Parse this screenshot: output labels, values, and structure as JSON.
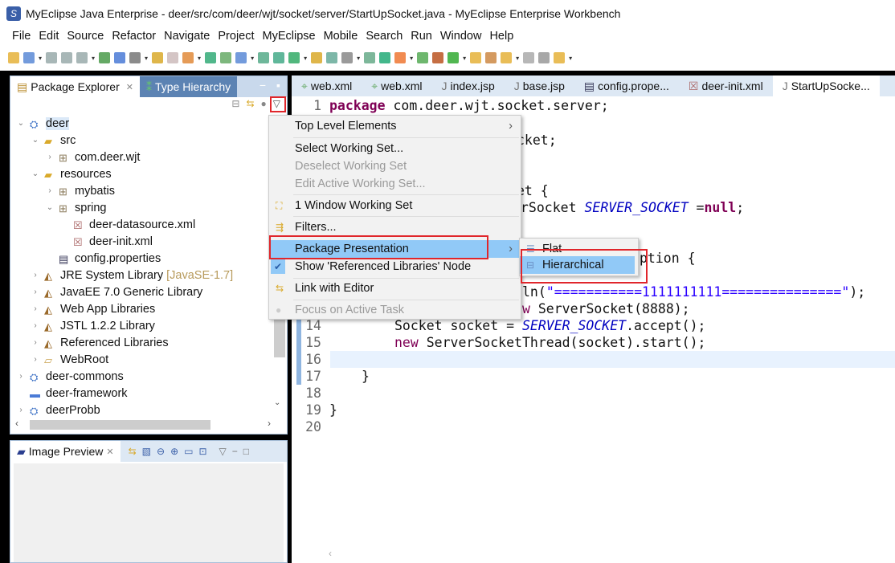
{
  "window": {
    "title": "MyEclipse Java Enterprise - deer/src/com/deer/wjt/socket/server/StartUpSocket.java - MyEclipse Enterprise Workbench"
  },
  "menubar": [
    "File",
    "Edit",
    "Source",
    "Refactor",
    "Navigate",
    "Project",
    "MyEclipse",
    "Mobile",
    "Search",
    "Run",
    "Window",
    "Help"
  ],
  "left_panel": {
    "tabs": [
      {
        "label": "Package Explorer"
      },
      {
        "label": "Type Hierarchy"
      }
    ],
    "tree": [
      {
        "label": "deer",
        "depth": 0,
        "twisty": "v",
        "icon": "project-icon"
      },
      {
        "label": "src",
        "depth": 1,
        "twisty": "v",
        "icon": "source-folder-icon"
      },
      {
        "label": "com.deer.wjt",
        "depth": 2,
        "twisty": ">",
        "icon": "package-icon"
      },
      {
        "label": "resources",
        "depth": 1,
        "twisty": "v",
        "icon": "source-folder-icon"
      },
      {
        "label": "mybatis",
        "depth": 2,
        "twisty": ">",
        "icon": "package-icon"
      },
      {
        "label": "spring",
        "depth": 2,
        "twisty": "v",
        "icon": "package-icon"
      },
      {
        "label": "deer-datasource.xml",
        "depth": 3,
        "twisty": "",
        "icon": "xml-file-icon"
      },
      {
        "label": "deer-init.xml",
        "depth": 3,
        "twisty": "",
        "icon": "xml-file-icon"
      },
      {
        "label": "config.properties",
        "depth": 2,
        "twisty": "",
        "icon": "properties-file-icon"
      },
      {
        "label": "JRE System Library",
        "suffix": "[JavaSE-1.7]",
        "depth": 1,
        "twisty": ">",
        "icon": "library-icon"
      },
      {
        "label": "JavaEE 7.0 Generic Library",
        "depth": 1,
        "twisty": ">",
        "icon": "library-icon"
      },
      {
        "label": "Web App Libraries",
        "depth": 1,
        "twisty": ">",
        "icon": "library-icon"
      },
      {
        "label": "JSTL 1.2.2 Library",
        "depth": 1,
        "twisty": ">",
        "icon": "library-icon"
      },
      {
        "label": "Referenced Libraries",
        "depth": 1,
        "twisty": ">",
        "icon": "library-icon"
      },
      {
        "label": "WebRoot",
        "depth": 1,
        "twisty": ">",
        "icon": "folder-icon"
      },
      {
        "label": "deer-commons",
        "depth": 0,
        "twisty": ">",
        "icon": "project-icon"
      },
      {
        "label": "deer-framework",
        "depth": 0,
        "twisty": "",
        "icon": "closed-project-icon"
      },
      {
        "label": "deerProbb",
        "depth": 0,
        "twisty": ">",
        "icon": "project-icon"
      }
    ]
  },
  "preview_panel": {
    "tab": "Image Preview"
  },
  "editor": {
    "tabs": [
      "web.xml",
      "web.xml",
      "index.jsp",
      "base.jsp",
      "config.prope...",
      "deer-init.xml",
      "StartUpSocke..."
    ],
    "line_numbers": [
      "1",
      "14",
      "15",
      "16",
      "17",
      "18",
      "19",
      "20"
    ],
    "code": {
      "l1_kw": "package",
      "l1_rest": " com.deer.wjt.socket.server;",
      "l3": "cket;",
      "l6": "et {",
      "l7a": "rSocket ",
      "l7b": "SERVER_SOCKET",
      "l7c": " =",
      "l7d": "null",
      "l7e": ";",
      "l10": "ption {",
      "l12a": "ln(",
      "l12b": "\"===========1111111111===============\"",
      "l12c": ");",
      "l13a": "w",
      "l13b": " ServerSocket(8888);",
      "l14a": "Socket socket = ",
      "l14b": "SERVER_SOCKET",
      "l14c": ".accept();",
      "l15a": "new",
      "l15b": " ServerSocketThread(socket).start();",
      "l17": "}",
      "l19": "}"
    }
  },
  "context_menu": {
    "items": [
      {
        "label": "Top Level Elements",
        "submenu": true
      },
      {
        "label": "Select Working Set..."
      },
      {
        "label": "Deselect Working Set",
        "disabled": true
      },
      {
        "label": "Edit Active Working Set...",
        "disabled": true
      },
      {
        "label": "1 Window Working Set"
      },
      {
        "label": "Filters..."
      },
      {
        "label": "Package Presentation",
        "submenu": true,
        "selected": true
      },
      {
        "label": "Show 'Referenced Libraries' Node",
        "checked": true
      },
      {
        "label": "Link with Editor"
      },
      {
        "label": "Focus on Active Task",
        "disabled": true
      }
    ]
  },
  "submenu": {
    "items": [
      {
        "label": "Flat"
      },
      {
        "label": "Hierarchical",
        "selected": true
      }
    ]
  },
  "colors": {
    "highlight": "#e0262b",
    "selection": "#91c9f7",
    "keyword": "#7f0055",
    "string": "#2a00ff",
    "static_field": "#0000c0"
  }
}
